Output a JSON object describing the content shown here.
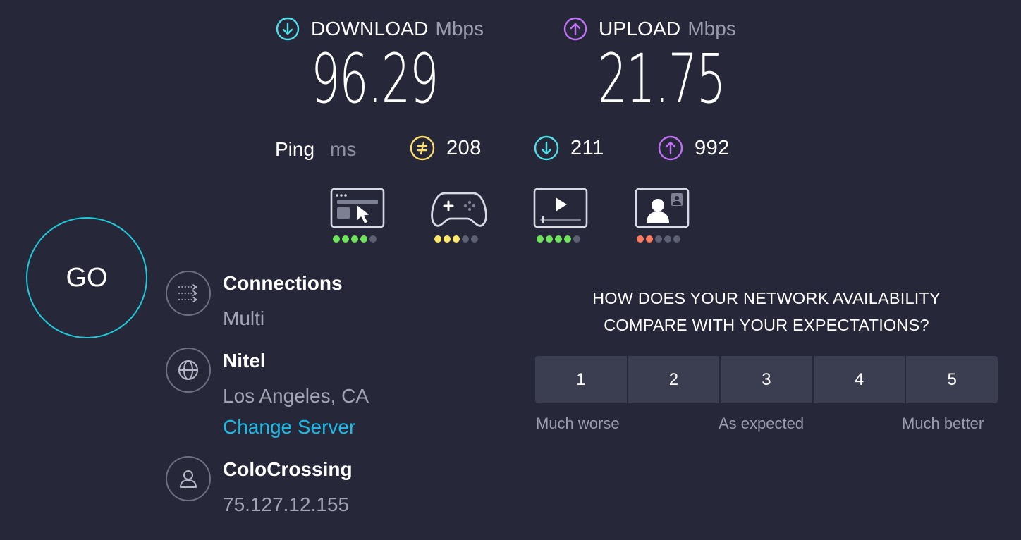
{
  "download": {
    "title": "DOWNLOAD",
    "unit": "Mbps",
    "value": "96.29",
    "icon": "arrow-down-circle-icon",
    "color": "#4fe0e8"
  },
  "upload": {
    "title": "UPLOAD",
    "unit": "Mbps",
    "value": "21.75",
    "icon": "arrow-up-circle-icon",
    "color": "#bf71f4"
  },
  "ping": {
    "label": "Ping",
    "unit": "ms",
    "idle": {
      "value": "208",
      "icon": "idle-latency-icon",
      "color": "#ffde6b"
    },
    "download": {
      "value": "211",
      "icon": "download-latency-icon",
      "color": "#4fe0e8"
    },
    "upload": {
      "value": "992",
      "icon": "upload-latency-icon",
      "color": "#bf71f4"
    }
  },
  "experiences": [
    {
      "name": "web-browsing",
      "icon": "browser-cursor-icon",
      "rating": 4,
      "of": 5,
      "color": "#6ee45a"
    },
    {
      "name": "gaming",
      "icon": "gamepad-icon",
      "rating": 3,
      "of": 5,
      "color": "#ffe866"
    },
    {
      "name": "video-streaming",
      "icon": "video-player-icon",
      "rating": 4,
      "of": 5,
      "color": "#6ee45a"
    },
    {
      "name": "video-chat",
      "icon": "video-chat-icon",
      "rating": 2,
      "of": 5,
      "color": "#ff7a5c"
    }
  ],
  "go_button": {
    "label": "GO"
  },
  "connections": {
    "title": "Connections",
    "value": "Multi",
    "icon": "connections-icon"
  },
  "server": {
    "name": "Nitel",
    "location": "Los Angeles, CA",
    "change_label": "Change Server",
    "icon": "globe-icon"
  },
  "provider": {
    "name": "ColoCrossing",
    "ip": "75.127.12.155",
    "icon": "user-icon"
  },
  "survey": {
    "question_line1": "HOW DOES YOUR NETWORK AVAILABILITY",
    "question_line2": "COMPARE WITH YOUR EXPECTATIONS?",
    "options": [
      "1",
      "2",
      "3",
      "4",
      "5"
    ],
    "low_label": "Much worse",
    "mid_label": "As expected",
    "high_label": "Much better"
  }
}
